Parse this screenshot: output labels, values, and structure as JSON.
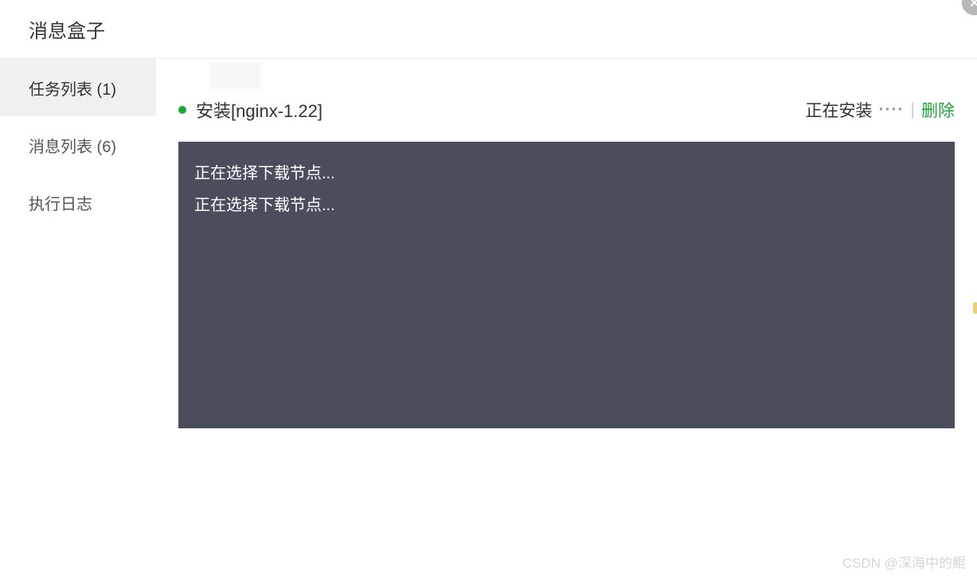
{
  "header": {
    "title": "消息盒子"
  },
  "sidebar": {
    "items": [
      {
        "label": "任务列表 (1)",
        "active": true
      },
      {
        "label": "消息列表 (6)",
        "active": false
      },
      {
        "label": "执行日志",
        "active": false
      }
    ]
  },
  "task": {
    "title": "安装[nginx-1.22]",
    "status": "正在安装",
    "loading": "····",
    "separator": "|",
    "delete": "删除"
  },
  "console": {
    "lines": [
      "正在选择下载节点...",
      "正在选择下载节点..."
    ]
  },
  "watermark": "CSDN @深海中的鲲"
}
